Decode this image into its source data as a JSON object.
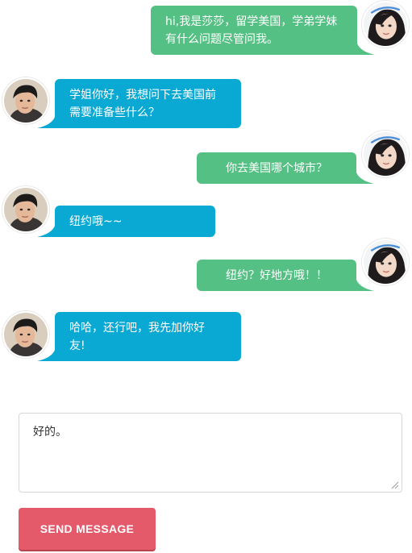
{
  "colors": {
    "sent_bubble": "#55c084",
    "received_bubble": "#0aa9d4",
    "send_button": "#e55a6b"
  },
  "messages": [
    {
      "side": "right",
      "avatar": "female-avatar",
      "text_lines": [
        "hi,我是莎莎，留学美国，学弟学妹",
        "有什么问题尽管问我。"
      ]
    },
    {
      "side": "left",
      "avatar": "male-avatar",
      "text_lines": [
        "学姐你好，我想问下去美国前",
        "需要准备些什么？"
      ]
    },
    {
      "side": "right",
      "avatar": "female-avatar",
      "text_lines": [
        "你去美国哪个城市？"
      ]
    },
    {
      "side": "left",
      "avatar": "male-avatar",
      "text_lines": [
        "纽约哦~~"
      ]
    },
    {
      "side": "right",
      "avatar": "female-avatar",
      "text_lines": [
        "纽约？好地方哦！！"
      ]
    },
    {
      "side": "left",
      "avatar": "male-avatar",
      "text_lines": [
        "哈哈，还行吧，我先加你好",
        "友!"
      ]
    }
  ],
  "composer": {
    "value": "好的。",
    "send_label": "SEND MESSAGE"
  }
}
